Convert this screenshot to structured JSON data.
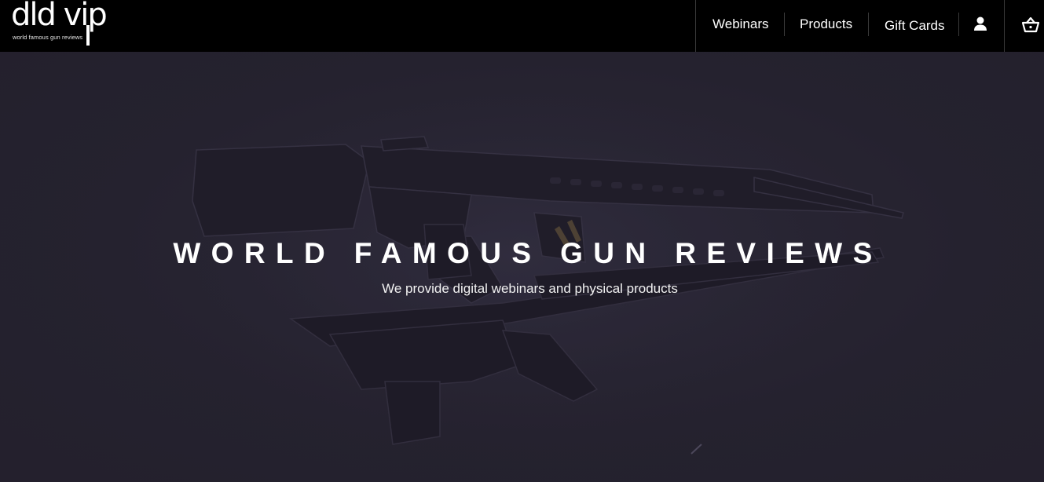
{
  "header": {
    "logo": {
      "wordmark": "dld vip",
      "tagline": "world famous gun reviews"
    },
    "nav": [
      {
        "label": "Webinars"
      },
      {
        "label": "Products"
      },
      {
        "label": "Gift Cards"
      }
    ],
    "icons": {
      "account": "user-icon",
      "cart": "basket-icon"
    }
  },
  "hero": {
    "title": "WORLD FAMOUS GUN REVIEWS",
    "subtitle": "We provide digital webinars and physical products",
    "background": "dark-firearms-photo"
  },
  "colors": {
    "header_bg": "#000000",
    "hero_bg": "#26232f",
    "text": "#ffffff",
    "divider": "#3a3a3a"
  }
}
